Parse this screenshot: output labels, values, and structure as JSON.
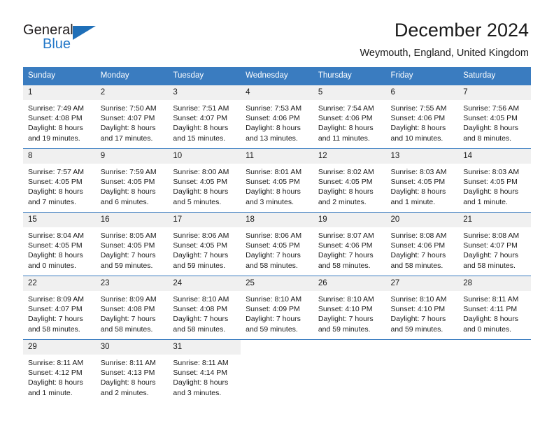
{
  "brand": {
    "name_top": "General",
    "name_bottom": "Blue",
    "triangle_icon": "triangle-icon",
    "accent_color": "#1f6fb8"
  },
  "header": {
    "title": "December 2024",
    "subtitle": "Weymouth, England, United Kingdom"
  },
  "calendar": {
    "header_bg": "#3a7cc0",
    "daynum_bg": "#f0f0f0",
    "weekday_headers": [
      "Sunday",
      "Monday",
      "Tuesday",
      "Wednesday",
      "Thursday",
      "Friday",
      "Saturday"
    ],
    "weeks": [
      [
        {
          "day": "1",
          "sunrise": "Sunrise: 7:49 AM",
          "sunset": "Sunset: 4:08 PM",
          "daylight_line1": "Daylight: 8 hours",
          "daylight_line2": "and 19 minutes."
        },
        {
          "day": "2",
          "sunrise": "Sunrise: 7:50 AM",
          "sunset": "Sunset: 4:07 PM",
          "daylight_line1": "Daylight: 8 hours",
          "daylight_line2": "and 17 minutes."
        },
        {
          "day": "3",
          "sunrise": "Sunrise: 7:51 AM",
          "sunset": "Sunset: 4:07 PM",
          "daylight_line1": "Daylight: 8 hours",
          "daylight_line2": "and 15 minutes."
        },
        {
          "day": "4",
          "sunrise": "Sunrise: 7:53 AM",
          "sunset": "Sunset: 4:06 PM",
          "daylight_line1": "Daylight: 8 hours",
          "daylight_line2": "and 13 minutes."
        },
        {
          "day": "5",
          "sunrise": "Sunrise: 7:54 AM",
          "sunset": "Sunset: 4:06 PM",
          "daylight_line1": "Daylight: 8 hours",
          "daylight_line2": "and 11 minutes."
        },
        {
          "day": "6",
          "sunrise": "Sunrise: 7:55 AM",
          "sunset": "Sunset: 4:06 PM",
          "daylight_line1": "Daylight: 8 hours",
          "daylight_line2": "and 10 minutes."
        },
        {
          "day": "7",
          "sunrise": "Sunrise: 7:56 AM",
          "sunset": "Sunset: 4:05 PM",
          "daylight_line1": "Daylight: 8 hours",
          "daylight_line2": "and 8 minutes."
        }
      ],
      [
        {
          "day": "8",
          "sunrise": "Sunrise: 7:57 AM",
          "sunset": "Sunset: 4:05 PM",
          "daylight_line1": "Daylight: 8 hours",
          "daylight_line2": "and 7 minutes."
        },
        {
          "day": "9",
          "sunrise": "Sunrise: 7:59 AM",
          "sunset": "Sunset: 4:05 PM",
          "daylight_line1": "Daylight: 8 hours",
          "daylight_line2": "and 6 minutes."
        },
        {
          "day": "10",
          "sunrise": "Sunrise: 8:00 AM",
          "sunset": "Sunset: 4:05 PM",
          "daylight_line1": "Daylight: 8 hours",
          "daylight_line2": "and 5 minutes."
        },
        {
          "day": "11",
          "sunrise": "Sunrise: 8:01 AM",
          "sunset": "Sunset: 4:05 PM",
          "daylight_line1": "Daylight: 8 hours",
          "daylight_line2": "and 3 minutes."
        },
        {
          "day": "12",
          "sunrise": "Sunrise: 8:02 AM",
          "sunset": "Sunset: 4:05 PM",
          "daylight_line1": "Daylight: 8 hours",
          "daylight_line2": "and 2 minutes."
        },
        {
          "day": "13",
          "sunrise": "Sunrise: 8:03 AM",
          "sunset": "Sunset: 4:05 PM",
          "daylight_line1": "Daylight: 8 hours",
          "daylight_line2": "and 1 minute."
        },
        {
          "day": "14",
          "sunrise": "Sunrise: 8:03 AM",
          "sunset": "Sunset: 4:05 PM",
          "daylight_line1": "Daylight: 8 hours",
          "daylight_line2": "and 1 minute."
        }
      ],
      [
        {
          "day": "15",
          "sunrise": "Sunrise: 8:04 AM",
          "sunset": "Sunset: 4:05 PM",
          "daylight_line1": "Daylight: 8 hours",
          "daylight_line2": "and 0 minutes."
        },
        {
          "day": "16",
          "sunrise": "Sunrise: 8:05 AM",
          "sunset": "Sunset: 4:05 PM",
          "daylight_line1": "Daylight: 7 hours",
          "daylight_line2": "and 59 minutes."
        },
        {
          "day": "17",
          "sunrise": "Sunrise: 8:06 AM",
          "sunset": "Sunset: 4:05 PM",
          "daylight_line1": "Daylight: 7 hours",
          "daylight_line2": "and 59 minutes."
        },
        {
          "day": "18",
          "sunrise": "Sunrise: 8:06 AM",
          "sunset": "Sunset: 4:05 PM",
          "daylight_line1": "Daylight: 7 hours",
          "daylight_line2": "and 58 minutes."
        },
        {
          "day": "19",
          "sunrise": "Sunrise: 8:07 AM",
          "sunset": "Sunset: 4:06 PM",
          "daylight_line1": "Daylight: 7 hours",
          "daylight_line2": "and 58 minutes."
        },
        {
          "day": "20",
          "sunrise": "Sunrise: 8:08 AM",
          "sunset": "Sunset: 4:06 PM",
          "daylight_line1": "Daylight: 7 hours",
          "daylight_line2": "and 58 minutes."
        },
        {
          "day": "21",
          "sunrise": "Sunrise: 8:08 AM",
          "sunset": "Sunset: 4:07 PM",
          "daylight_line1": "Daylight: 7 hours",
          "daylight_line2": "and 58 minutes."
        }
      ],
      [
        {
          "day": "22",
          "sunrise": "Sunrise: 8:09 AM",
          "sunset": "Sunset: 4:07 PM",
          "daylight_line1": "Daylight: 7 hours",
          "daylight_line2": "and 58 minutes."
        },
        {
          "day": "23",
          "sunrise": "Sunrise: 8:09 AM",
          "sunset": "Sunset: 4:08 PM",
          "daylight_line1": "Daylight: 7 hours",
          "daylight_line2": "and 58 minutes."
        },
        {
          "day": "24",
          "sunrise": "Sunrise: 8:10 AM",
          "sunset": "Sunset: 4:08 PM",
          "daylight_line1": "Daylight: 7 hours",
          "daylight_line2": "and 58 minutes."
        },
        {
          "day": "25",
          "sunrise": "Sunrise: 8:10 AM",
          "sunset": "Sunset: 4:09 PM",
          "daylight_line1": "Daylight: 7 hours",
          "daylight_line2": "and 59 minutes."
        },
        {
          "day": "26",
          "sunrise": "Sunrise: 8:10 AM",
          "sunset": "Sunset: 4:10 PM",
          "daylight_line1": "Daylight: 7 hours",
          "daylight_line2": "and 59 minutes."
        },
        {
          "day": "27",
          "sunrise": "Sunrise: 8:10 AM",
          "sunset": "Sunset: 4:10 PM",
          "daylight_line1": "Daylight: 7 hours",
          "daylight_line2": "and 59 minutes."
        },
        {
          "day": "28",
          "sunrise": "Sunrise: 8:11 AM",
          "sunset": "Sunset: 4:11 PM",
          "daylight_line1": "Daylight: 8 hours",
          "daylight_line2": "and 0 minutes."
        }
      ],
      [
        {
          "day": "29",
          "sunrise": "Sunrise: 8:11 AM",
          "sunset": "Sunset: 4:12 PM",
          "daylight_line1": "Daylight: 8 hours",
          "daylight_line2": "and 1 minute."
        },
        {
          "day": "30",
          "sunrise": "Sunrise: 8:11 AM",
          "sunset": "Sunset: 4:13 PM",
          "daylight_line1": "Daylight: 8 hours",
          "daylight_line2": "and 2 minutes."
        },
        {
          "day": "31",
          "sunrise": "Sunrise: 8:11 AM",
          "sunset": "Sunset: 4:14 PM",
          "daylight_line1": "Daylight: 8 hours",
          "daylight_line2": "and 3 minutes."
        },
        {
          "day": "",
          "sunrise": "",
          "sunset": "",
          "daylight_line1": "",
          "daylight_line2": ""
        },
        {
          "day": "",
          "sunrise": "",
          "sunset": "",
          "daylight_line1": "",
          "daylight_line2": ""
        },
        {
          "day": "",
          "sunrise": "",
          "sunset": "",
          "daylight_line1": "",
          "daylight_line2": ""
        },
        {
          "day": "",
          "sunrise": "",
          "sunset": "",
          "daylight_line1": "",
          "daylight_line2": ""
        }
      ]
    ]
  }
}
